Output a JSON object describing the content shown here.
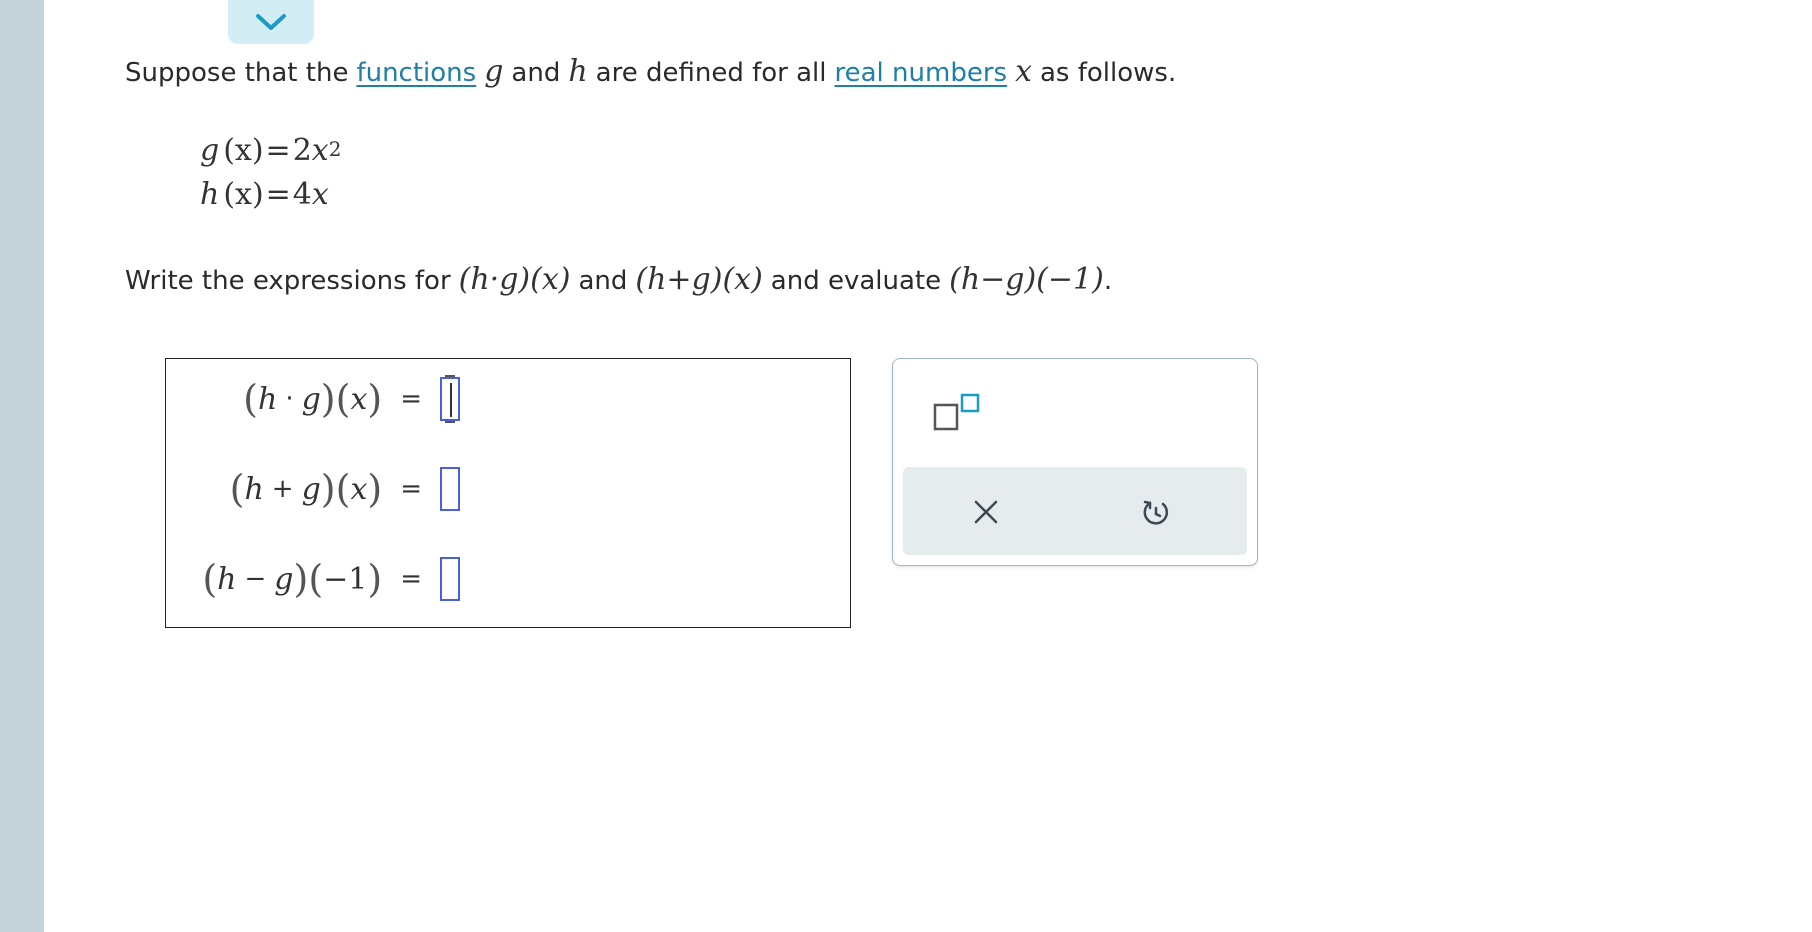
{
  "intro": {
    "t1": "Suppose that the",
    "link_functions": "functions",
    "var_g": "g",
    "t2": "and",
    "var_h": "h",
    "t3": "are defined for all",
    "link_real_numbers": "real numbers",
    "var_x": "x",
    "t4": "as follows."
  },
  "definitions": {
    "g_lhs": "g",
    "g_arg": "(x)",
    "g_eq": "=",
    "g_coef": "2",
    "g_var": "x",
    "g_exp": "2",
    "h_lhs": "h",
    "h_arg": "(x)",
    "h_eq": "=",
    "h_coef": "4",
    "h_var": "x"
  },
  "instruction": {
    "t1": "Write the expressions for",
    "expr1": "(h·g)(x)",
    "t2": "and",
    "expr2": "(h+g)(x)",
    "t3": "and evaluate",
    "expr3": "(h−g)(−1)",
    "t4": "."
  },
  "answers": [
    {
      "h": "h",
      "op": "·",
      "g": "g",
      "arg": "x",
      "eq": "=",
      "value": ""
    },
    {
      "h": "h",
      "op": "+",
      "g": "g",
      "arg": "x",
      "eq": "=",
      "value": ""
    },
    {
      "h": "h",
      "op": "−",
      "g": "g",
      "arg": "−1",
      "eq": "=",
      "value": ""
    }
  ],
  "tools": {
    "exponent_icon": "exponent-template-icon",
    "clear_icon": "close-icon",
    "undo_icon": "undo-icon",
    "accent": "#1f7fa8",
    "input_border": "#4a5ee0"
  }
}
